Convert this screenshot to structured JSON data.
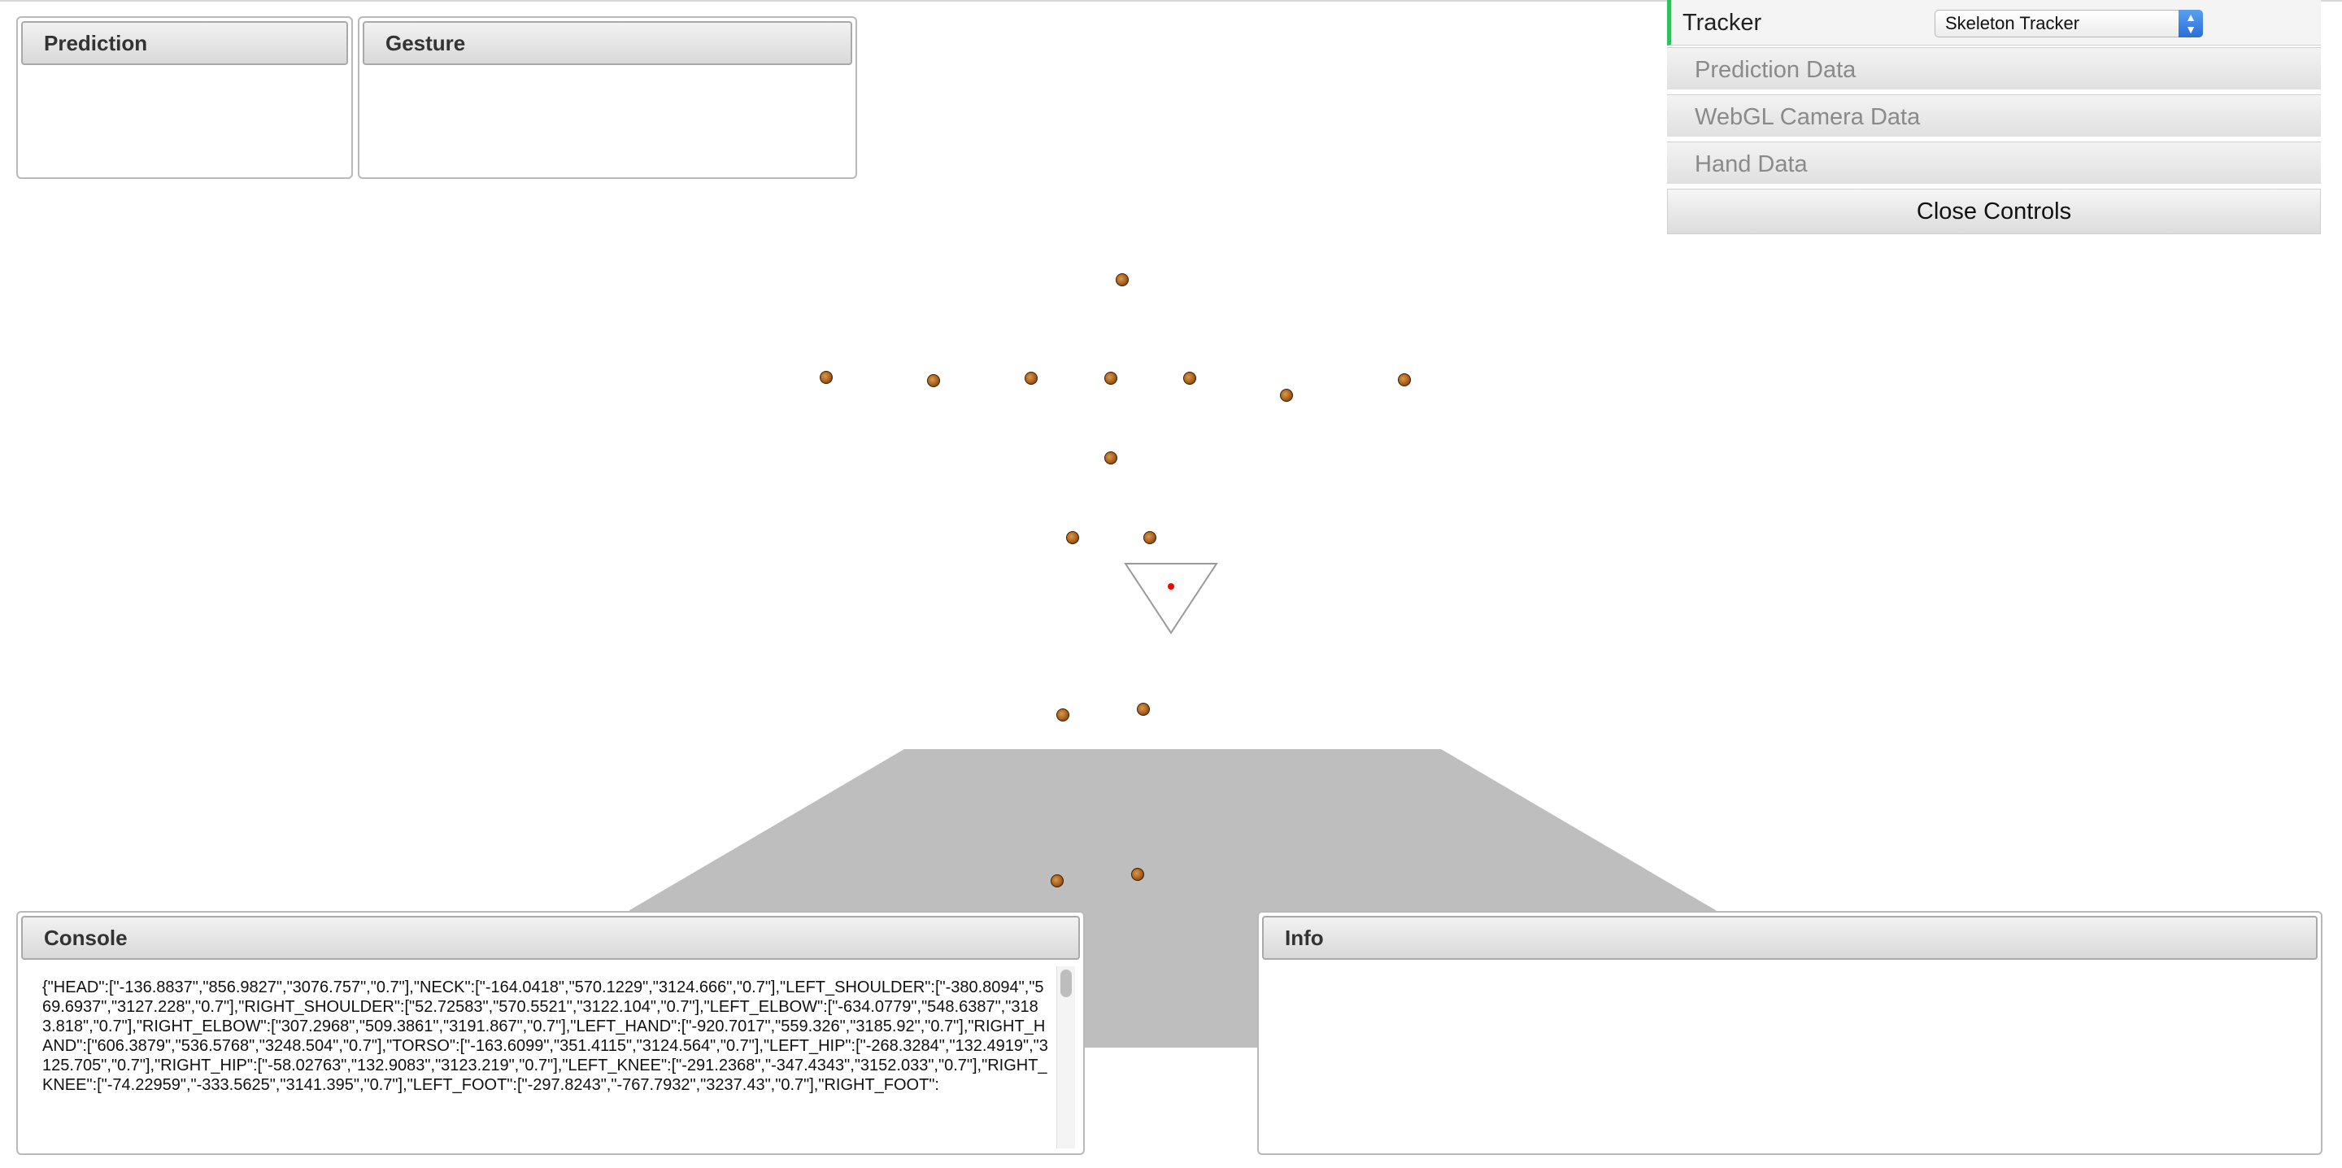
{
  "panels": {
    "prediction_title": "Prediction",
    "gesture_title": "Gesture",
    "console_title": "Console",
    "info_title": "Info"
  },
  "console": {
    "text": "{\"HEAD\":[\"-136.8837\",\"856.9827\",\"3076.757\",\"0.7\"],\"NECK\":[\"-164.0418\",\"570.1229\",\"3124.666\",\"0.7\"],\"LEFT_SHOULDER\":[\"-380.8094\",\"569.6937\",\"3127.228\",\"0.7\"],\"RIGHT_SHOULDER\":[\"52.72583\",\"570.5521\",\"3122.104\",\"0.7\"],\"LEFT_ELBOW\":[\"-634.0779\",\"548.6387\",\"3183.818\",\"0.7\"],\"RIGHT_ELBOW\":[\"307.2968\",\"509.3861\",\"3191.867\",\"0.7\"],\"LEFT_HAND\":[\"-920.7017\",\"559.326\",\"3185.92\",\"0.7\"],\"RIGHT_HAND\":[\"606.3879\",\"536.5768\",\"3248.504\",\"0.7\"],\"TORSO\":[\"-163.6099\",\"351.4115\",\"3124.564\",\"0.7\"],\"LEFT_HIP\":[\"-268.3284\",\"132.4919\",\"3125.705\",\"0.7\"],\"RIGHT_HIP\":[\"-58.02763\",\"132.9083\",\"3123.219\",\"0.7\"],\"LEFT_KNEE\":[\"-291.2368\",\"-347.4343\",\"3152.033\",\"0.7\"],\"RIGHT_KNEE\":[\"-74.22959\",\"-333.5625\",\"3141.395\",\"0.7\"],\"LEFT_FOOT\":[\"-297.8243\",\"-767.7932\",\"3237.43\",\"0.7\"],\"RIGHT_FOOT\":"
  },
  "controls": {
    "tracker_label": "Tracker",
    "tracker_selected": "Skeleton Tracker",
    "folders": [
      "Prediction Data",
      "WebGL Camera Data",
      "Hand Data"
    ],
    "close_label": "Close Controls",
    "accent_color": "#2fbf60"
  },
  "scene": {
    "floor_color": "#bebebe",
    "joint_color": "#a85f1c",
    "camera_marker_color": "#ff0000"
  }
}
